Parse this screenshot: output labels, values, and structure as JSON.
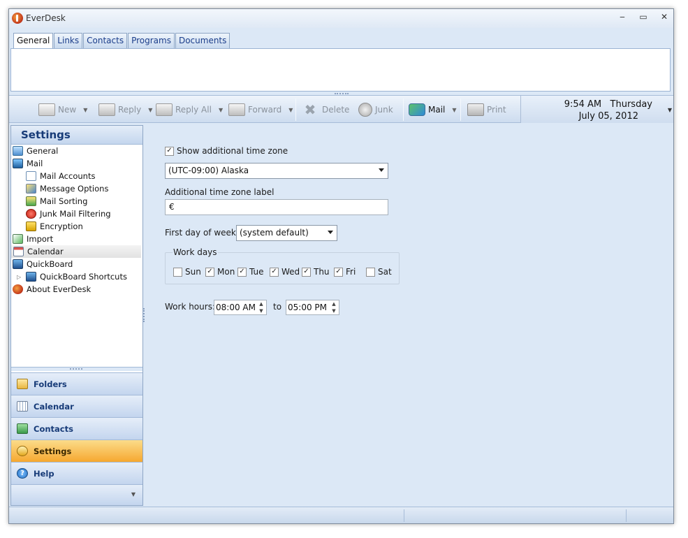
{
  "window": {
    "title": "EverDesk",
    "minimize": "‒",
    "maximize": "▭",
    "close": "✕"
  },
  "tabs": [
    {
      "label": "General",
      "active": true
    },
    {
      "label": "Links"
    },
    {
      "label": "Contacts"
    },
    {
      "label": "Programs"
    },
    {
      "label": "Documents"
    }
  ],
  "toolbar": {
    "new": "New",
    "reply": "Reply",
    "reply_all": "Reply All",
    "forward": "Forward",
    "delete": "Delete",
    "junk": "Junk",
    "mail": "Mail",
    "print": "Print"
  },
  "clock": {
    "time": "9:54 AM",
    "day": "Thursday",
    "date": "July 05, 2012"
  },
  "sidebar": {
    "title": "Settings",
    "tree": [
      {
        "label": "General",
        "icon": "general-icon"
      },
      {
        "label": "Mail",
        "icon": "mail-icon"
      },
      {
        "label": "Mail Accounts",
        "icon": "mail-accounts-icon"
      },
      {
        "label": "Message Options",
        "icon": "message-options-icon"
      },
      {
        "label": "Mail Sorting",
        "icon": "mail-sorting-icon"
      },
      {
        "label": "Junk Mail Filtering",
        "icon": "junk-filter-icon"
      },
      {
        "label": "Encryption",
        "icon": "lock-icon"
      },
      {
        "label": "Import",
        "icon": "import-icon"
      },
      {
        "label": "Calendar",
        "icon": "calendar-icon",
        "selected": true
      },
      {
        "label": "QuickBoard",
        "icon": "quickboard-icon"
      },
      {
        "label": "QuickBoard Shortcuts",
        "icon": "quickboard-shortcuts-icon"
      },
      {
        "label": "About EverDesk",
        "icon": "app-logo-icon"
      }
    ],
    "nav": [
      {
        "label": "Folders",
        "icon": "folder-icon"
      },
      {
        "label": "Calendar",
        "icon": "calendar-icon"
      },
      {
        "label": "Contacts",
        "icon": "contacts-icon"
      },
      {
        "label": "Settings",
        "icon": "settings-icon",
        "active": true
      },
      {
        "label": "Help",
        "icon": "help-icon"
      }
    ]
  },
  "calendar_settings": {
    "show_tz_label": "Show additional time zone",
    "show_tz_checked": true,
    "timezone_value": "(UTC-09:00) Alaska",
    "tz_label_caption": "Additional time zone label",
    "tz_label_value": "€",
    "first_day_label": "First day of week:",
    "first_day_value": "(system default)",
    "work_days_title": "Work days",
    "work_days": [
      {
        "label": "Sun",
        "checked": false
      },
      {
        "label": "Mon",
        "checked": true
      },
      {
        "label": "Tue",
        "checked": true
      },
      {
        "label": "Wed",
        "checked": true
      },
      {
        "label": "Thu",
        "checked": true
      },
      {
        "label": "Fri",
        "checked": true
      },
      {
        "label": "Sat",
        "checked": false
      }
    ],
    "work_hours_label": "Work hours:",
    "work_start": "08:00 AM",
    "to_label": "to",
    "work_end": "05:00 PM"
  },
  "colors": {
    "accent": "#dce8f6",
    "active_nav": "#f6a830",
    "header_text": "#173b78"
  }
}
